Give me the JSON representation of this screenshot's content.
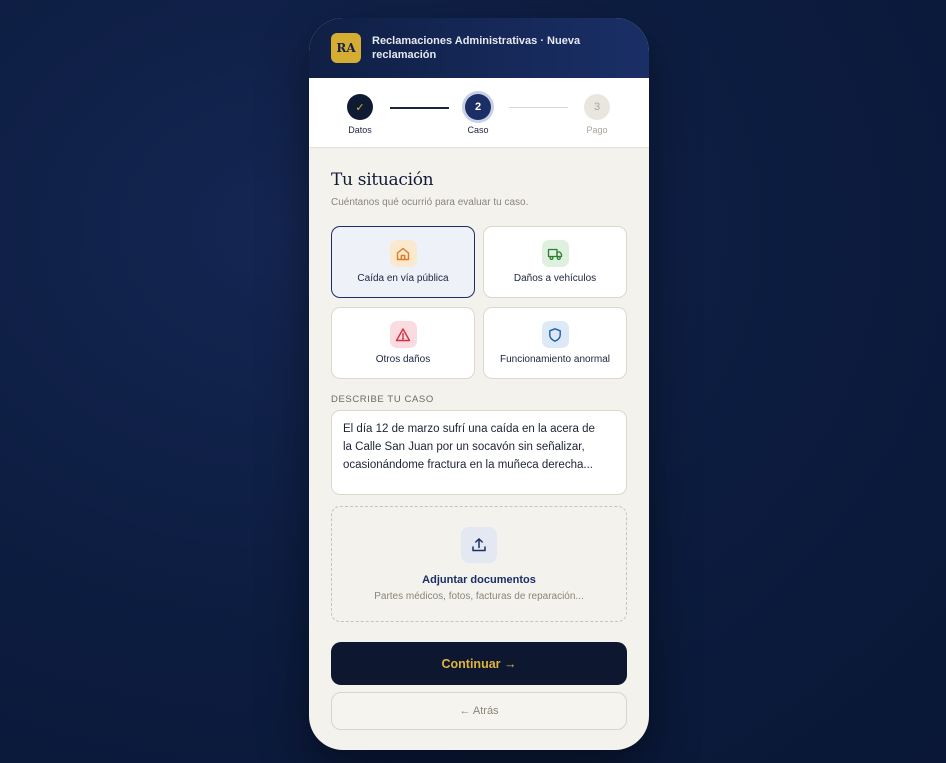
{
  "header": {
    "logo_text": "RA",
    "title": "Reclamaciones Administrativas · Nueva reclamación"
  },
  "stepper": {
    "steps": [
      {
        "number": "✓",
        "label": "Datos",
        "state": "done"
      },
      {
        "number": "2",
        "label": "Caso",
        "state": "active"
      },
      {
        "number": "3",
        "label": "Pago",
        "state": "pending"
      }
    ]
  },
  "main": {
    "title": "Tu situación",
    "subtitle": "Cuéntanos qué ocurrió para evaluar tu caso.",
    "options": [
      {
        "label": "Caída en vía pública",
        "icon": "home-icon",
        "color": "#e07a1f",
        "selected": true
      },
      {
        "label": "Daños a vehículos",
        "icon": "truck-icon",
        "color": "#2e7d32",
        "selected": false
      },
      {
        "label": "Otros daños",
        "icon": "warning-icon",
        "color": "#d32f3f",
        "selected": false
      },
      {
        "label": "Funcionamiento anormal",
        "icon": "shield-icon",
        "color": "#1e5fa8",
        "selected": false
      }
    ],
    "description_label": "DESCRIBE TU CASO",
    "description_lines": [
      "El día 12 de marzo sufrí una caída en la acera de",
      "la Calle San Juan por un socavón sin señalizar,",
      "ocasionándome fractura en la muñeca derecha..."
    ],
    "upload": {
      "title": "Adjuntar documentos",
      "subtitle": "Partes médicos, fotos, facturas de reparación..."
    },
    "continue_label": "Continuar →",
    "back_label": "← Atrás"
  },
  "colors": {
    "accent": "#1b2f66",
    "gold": "#e0b43a",
    "dark": "#0d1730"
  }
}
